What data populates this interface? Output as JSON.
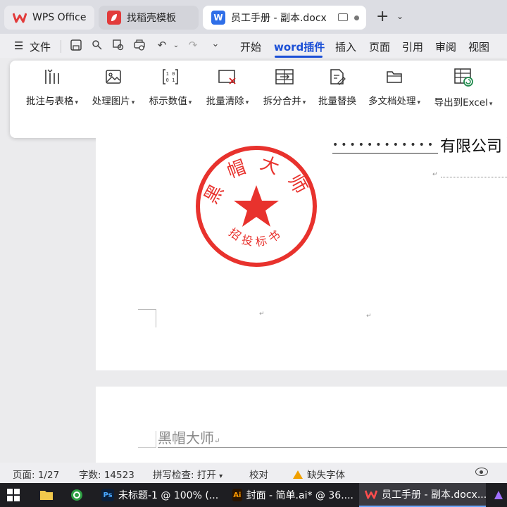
{
  "tabs": [
    {
      "label": "WPS Office"
    },
    {
      "label": "找稻壳模板"
    },
    {
      "label": "员工手册 - 副本.docx"
    }
  ],
  "menubar": {
    "file_label": "文件",
    "items": [
      "开始",
      "word插件",
      "插入",
      "页面",
      "引用",
      "审阅",
      "视图"
    ],
    "active": "word插件"
  },
  "ribbon": {
    "items": [
      {
        "label": "批注与表格",
        "icon": "column-insert-icon",
        "dropdown": true
      },
      {
        "label": "处理图片",
        "icon": "image-icon",
        "dropdown": true
      },
      {
        "label": "标示数值",
        "icon": "number-bracket-icon",
        "dropdown": true
      },
      {
        "label": "批量清除",
        "icon": "clear-box-icon",
        "dropdown": true
      },
      {
        "label": "拆分合并",
        "icon": "split-merge-icon",
        "dropdown": true
      },
      {
        "label": "批量替换",
        "icon": "replace-edit-icon",
        "dropdown": false
      },
      {
        "label": "多文档处理",
        "icon": "folder-icon",
        "dropdown": true
      },
      {
        "label": "导出到Excel",
        "icon": "excel-export-icon",
        "dropdown": true
      }
    ]
  },
  "document": {
    "company_suffix": "有限公司",
    "company_placeholder": "••••••••••••",
    "seal": {
      "top_text": "黑帽大师",
      "bottom_text": "招投标书",
      "color": "#e8322d"
    },
    "footer_text": "黑帽大师",
    "paragraph_mark": "↵"
  },
  "statusbar": {
    "page": "页面: 1/27",
    "word_count": "字数: 14523",
    "spellcheck": "拼写检查: 打开",
    "proofread": "校对",
    "missing_font": "缺失字体"
  },
  "taskbar": {
    "items": [
      {
        "label": "未标题-1 @ 100% (...",
        "icon": "Ps"
      },
      {
        "label": "封面 - 简单.ai* @ 36....",
        "icon": "Ai"
      },
      {
        "label": "员工手册 - 副本.docx...",
        "icon": "W"
      }
    ]
  },
  "colors": {
    "accent": "#1a4fd6",
    "wps_red": "#e23b3b",
    "seal_red": "#e8322d"
  }
}
